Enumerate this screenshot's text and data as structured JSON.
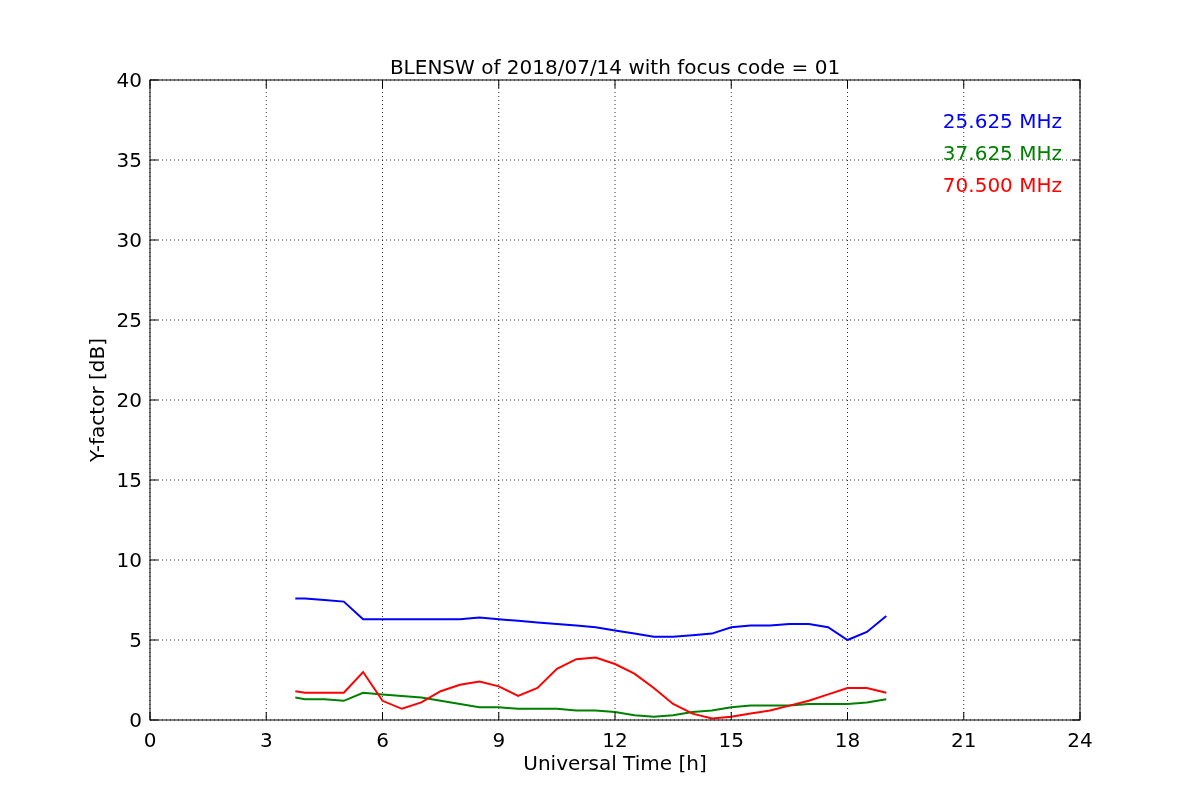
{
  "figure": {
    "chart_data": {
      "type": "line",
      "title": "BLENSW of 2018/07/14 with focus code = 01",
      "xlabel": "Universal Time [h]",
      "ylabel": "Y-factor [dB]",
      "x": [
        3.75,
        4,
        4.5,
        5,
        5.5,
        6,
        6.5,
        7,
        7.5,
        8,
        8.5,
        9,
        9.5,
        10,
        10.5,
        11,
        11.5,
        12,
        12.5,
        13,
        13.5,
        14,
        14.5,
        15,
        15.5,
        16,
        16.5,
        17,
        17.5,
        18,
        18.5,
        19
      ],
      "series": [
        {
          "name": "25.625 MHz",
          "color": "#0000ff",
          "values": [
            7.6,
            7.6,
            7.5,
            7.4,
            6.3,
            6.3,
            6.3,
            6.3,
            6.3,
            6.3,
            6.4,
            6.3,
            6.2,
            6.1,
            6.0,
            5.9,
            5.8,
            5.6,
            5.4,
            5.2,
            5.2,
            5.3,
            5.4,
            5.8,
            5.9,
            5.9,
            6.0,
            6.0,
            5.8,
            5.0,
            5.5,
            6.5
          ]
        },
        {
          "name": "37.625 MHz",
          "color": "#008000",
          "values": [
            1.4,
            1.3,
            1.3,
            1.2,
            1.7,
            1.6,
            1.5,
            1.4,
            1.2,
            1.0,
            0.8,
            0.8,
            0.7,
            0.7,
            0.7,
            0.6,
            0.6,
            0.5,
            0.3,
            0.2,
            0.3,
            0.5,
            0.6,
            0.8,
            0.9,
            0.9,
            0.9,
            1.0,
            1.0,
            1.0,
            1.1,
            1.3
          ]
        },
        {
          "name": "70.500 MHz",
          "color": "#ff0000",
          "values": [
            1.8,
            1.7,
            1.7,
            1.7,
            3.0,
            1.2,
            0.7,
            1.1,
            1.8,
            2.2,
            2.4,
            2.1,
            1.5,
            2.0,
            3.2,
            3.8,
            3.9,
            3.5,
            2.9,
            2.0,
            1.0,
            0.4,
            0.1,
            0.2,
            0.4,
            0.6,
            0.9,
            1.2,
            1.6,
            2.0,
            2.0,
            1.7
          ]
        }
      ],
      "grid": true,
      "xlim": [
        0,
        24
      ],
      "ylim": [
        0,
        40
      ],
      "xticks": [
        0,
        3,
        6,
        9,
        12,
        15,
        18,
        21,
        24
      ],
      "yticks": [
        0,
        5,
        10,
        15,
        20,
        25,
        30,
        35,
        40
      ]
    }
  }
}
